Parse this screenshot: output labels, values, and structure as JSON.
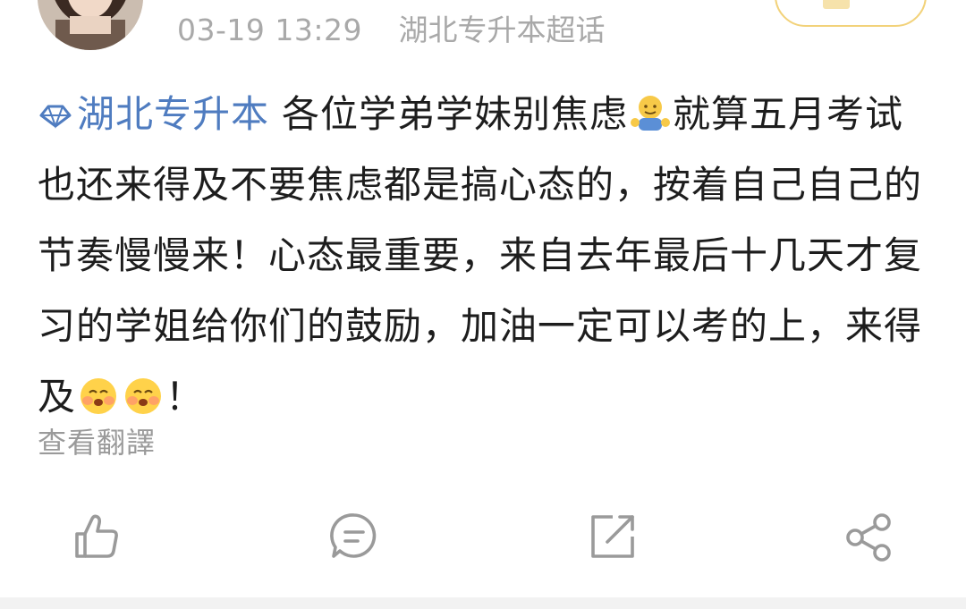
{
  "header": {
    "timestamp": "03-19 13:29",
    "source": "湖北专升本超话"
  },
  "post": {
    "topic_label": "湖北专升本",
    "text_part1": "各位学弟学妹别焦虑",
    "text_part2": "就算五月考试也还来得及不要焦虑都是搞心态的，按着自己自己的节奏慢慢来！心态最重要，来自去年最后十几天才复习的学姐给你们的鼓励，加油一定可以考的上，来得及",
    "text_part3": "！",
    "emojis": [
      "hug-emoji",
      "blush-emoji",
      "blush-emoji"
    ]
  },
  "translate": {
    "label": "查看翻譯"
  },
  "actions": {
    "items": [
      "like-icon",
      "comment-icon",
      "repost-icon",
      "share-icon"
    ]
  },
  "colors": {
    "topic": "#4f7cc0",
    "body_text": "#1d1d1d",
    "meta_text": "#a9a9a9",
    "icon_gray": "#9a9a9a",
    "follow_border": "#f2d27a"
  }
}
